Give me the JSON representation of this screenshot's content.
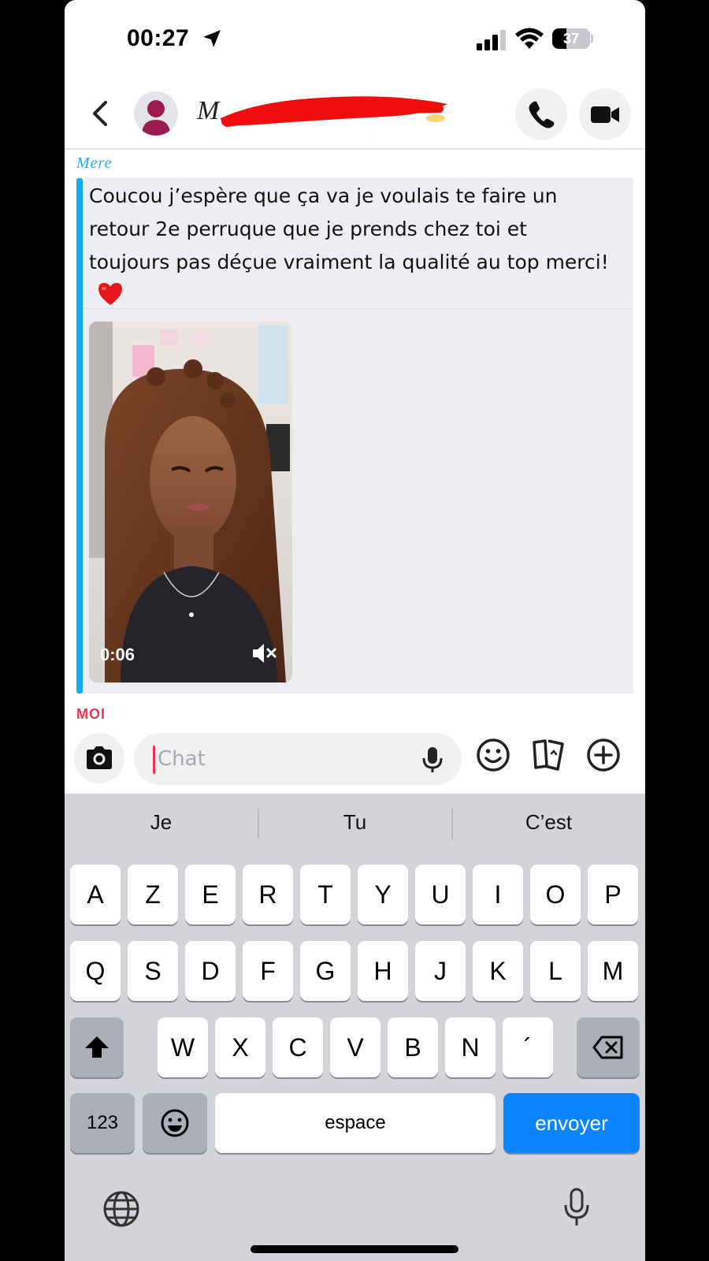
{
  "status_bar": {
    "time": "00:27",
    "battery_percent": 37,
    "battery_label": "37"
  },
  "header": {
    "contact_name": "M"
  },
  "conversation": {
    "sender_label": "Mere",
    "message_text": "Coucou j’espère que ça va je voulais te faire un retour 2e perruque que je prends chez toi et toujours pas déçue vraiment la qualité au top merci!",
    "video_duration": "0:06",
    "me_label": "MOI"
  },
  "input_bar": {
    "placeholder": "Chat"
  },
  "keyboard": {
    "suggestions": [
      "Je",
      "Tu",
      "C’est"
    ],
    "row1": [
      "A",
      "Z",
      "E",
      "R",
      "T",
      "Y",
      "U",
      "I",
      "O",
      "P"
    ],
    "row2": [
      "Q",
      "S",
      "D",
      "F",
      "G",
      "H",
      "J",
      "K",
      "L",
      "M"
    ],
    "row3": [
      "W",
      "X",
      "C",
      "V",
      "B",
      "N",
      "´"
    ],
    "numbers_label": "123",
    "space_label": "espace",
    "send_label": "envoyer"
  },
  "colors": {
    "accent_blue": "#0a84ff",
    "sender_blue": "#2da8e8",
    "message_bar": "#12aef0",
    "me_red": "#e8354f"
  }
}
